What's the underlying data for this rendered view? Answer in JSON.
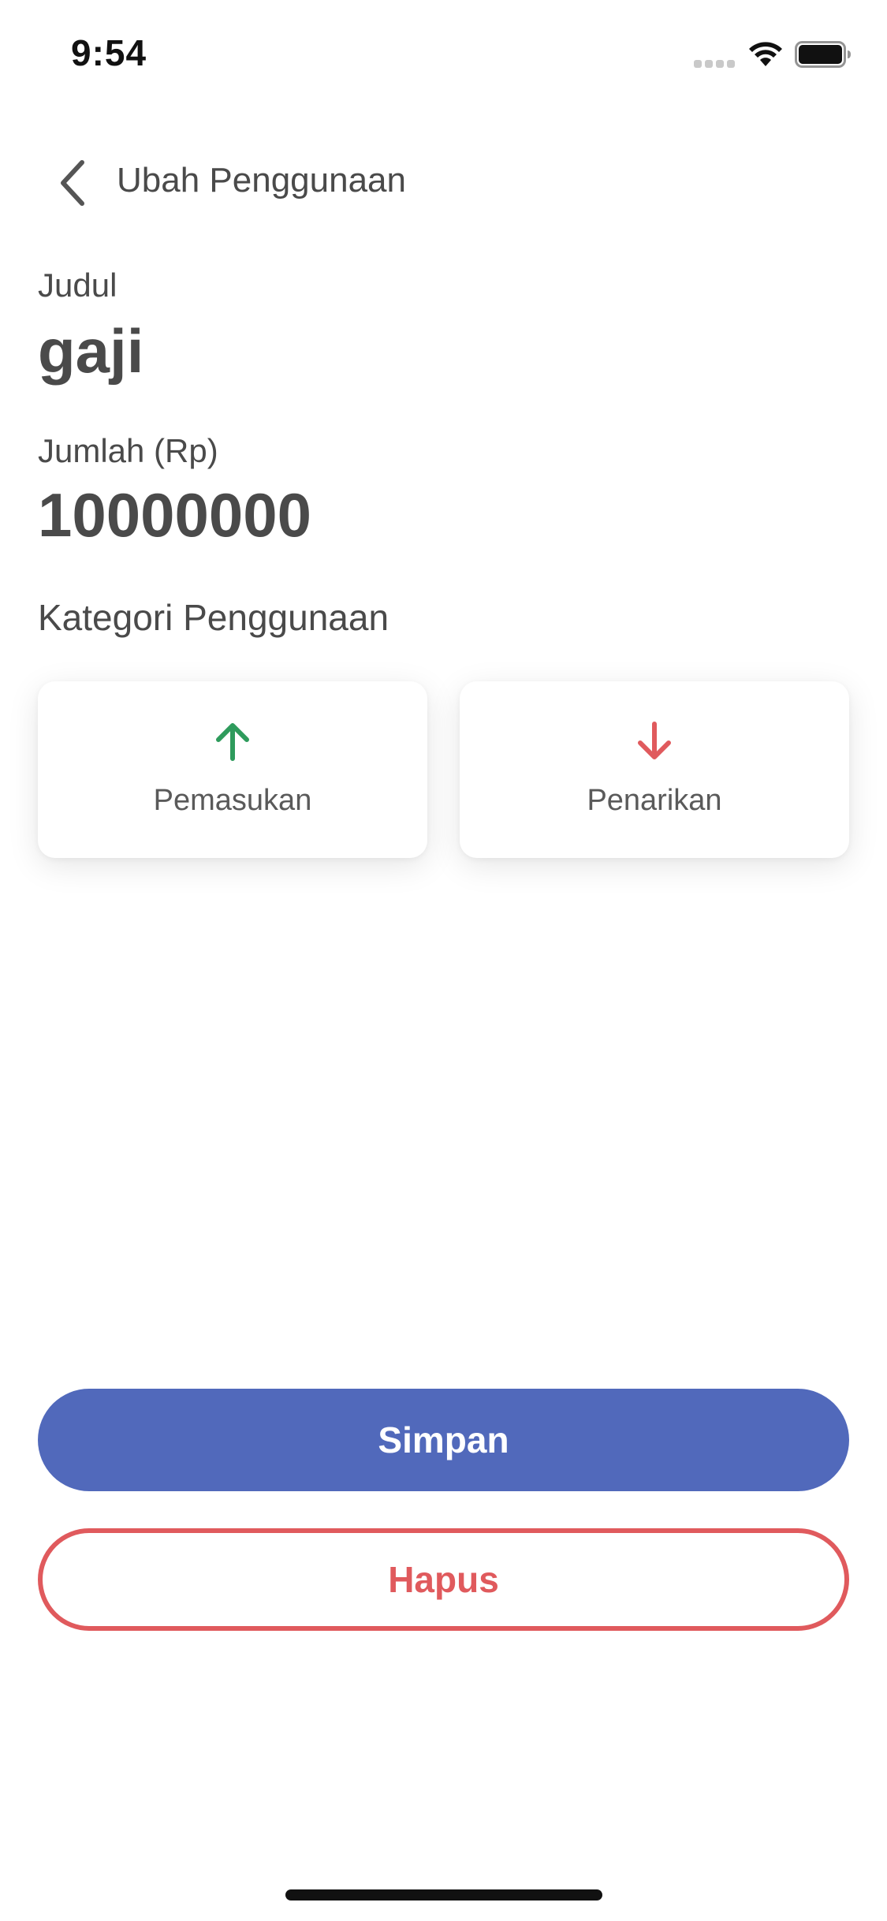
{
  "status_bar": {
    "time": "9:54",
    "icons": [
      "signal-icon",
      "wifi-icon",
      "battery-icon"
    ]
  },
  "header": {
    "back_icon": "chevron-left-icon",
    "title": "Ubah Penggunaan"
  },
  "form": {
    "title_label": "Judul",
    "title_value": "gaji",
    "amount_label": "Jumlah (Rp)",
    "amount_value": "10000000",
    "category_label": "Kategori Penggunaan"
  },
  "categories": [
    {
      "label": "Pemasukan",
      "icon": "arrow-up-icon",
      "color": "#2e9b5c"
    },
    {
      "label": "Penarikan",
      "icon": "arrow-down-icon",
      "color": "#e05a5d"
    }
  ],
  "actions": {
    "save_label": "Simpan",
    "delete_label": "Hapus"
  },
  "colors": {
    "primary": "#5169bb",
    "danger": "#e05a5d",
    "income": "#2e9b5c",
    "text": "#4a4a4a"
  }
}
